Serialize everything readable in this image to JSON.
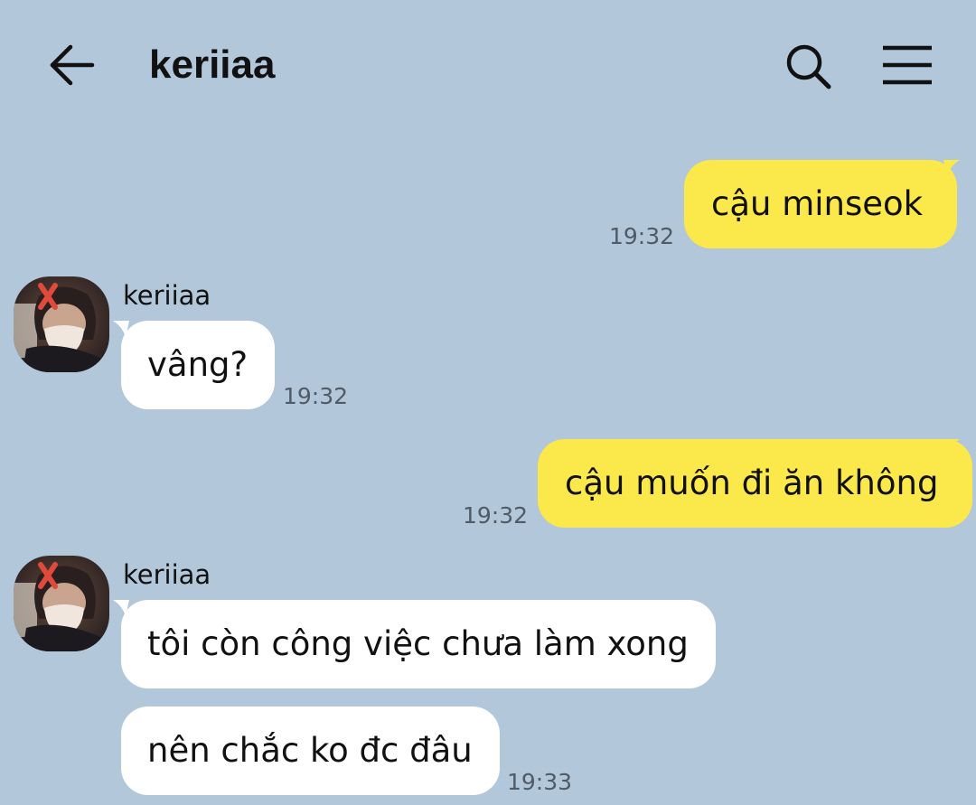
{
  "header": {
    "title": "keriiaa",
    "back_icon": "arrow-left-icon",
    "search_icon": "search-icon",
    "menu_icon": "hamburger-menu-icon"
  },
  "colors": {
    "background": "#b2c7da",
    "my_bubble": "#fbe84a",
    "their_bubble": "#ffffff",
    "timestamp": "#4f5b66"
  },
  "messages": [
    {
      "from": "me",
      "text": "cậu minseok",
      "time": "19:32"
    },
    {
      "from": "them",
      "sender": "keriiaa",
      "text": "vâng?",
      "time": "19:32"
    },
    {
      "from": "me",
      "text": "cậu muốn đi ăn không",
      "time": "19:32"
    },
    {
      "from": "them",
      "sender": "keriiaa",
      "text": "tôi còn công việc chưa làm xong"
    },
    {
      "from": "them",
      "text": "nên chắc ko đc đâu",
      "time": "19:33"
    }
  ]
}
